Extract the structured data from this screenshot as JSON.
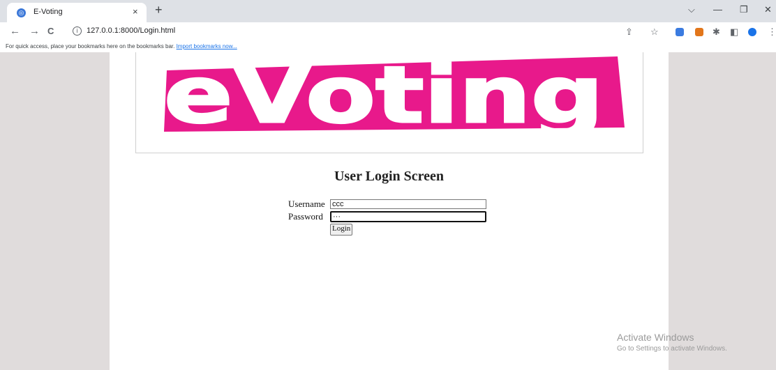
{
  "browser": {
    "tab_title": "E-Voting",
    "tab_close": "×",
    "new_tab": "+",
    "controls": {
      "dropdown": "⌵",
      "minimize": "—",
      "restore": "❐",
      "close": "✕"
    },
    "nav": {
      "back": "←",
      "forward": "→",
      "reload": "C"
    },
    "url": "127.0.0.1:8000/Login.html",
    "info": "i",
    "bookmarks_bar_text": "For quick access, place your bookmarks here on the bookmarks bar.",
    "bookmarks_bar_link": "Import bookmarks now...",
    "toolbar_icons": {
      "share": "⇪",
      "star": "☆",
      "puzzle": "✱",
      "sidepanel": "◧",
      "menu": "⋮"
    }
  },
  "page": {
    "banner_text": "eVoting",
    "login_title": "User Login Screen",
    "username_label": "Username",
    "username_value": "ccc",
    "password_label": "Password",
    "password_value": "···",
    "login_button": "Login"
  },
  "watermark": {
    "title": "Activate Windows",
    "subtitle": "Go to Settings to activate Windows."
  },
  "colors": {
    "banner_pink": "#e8198b",
    "side_bg": "#e0dcdc"
  }
}
